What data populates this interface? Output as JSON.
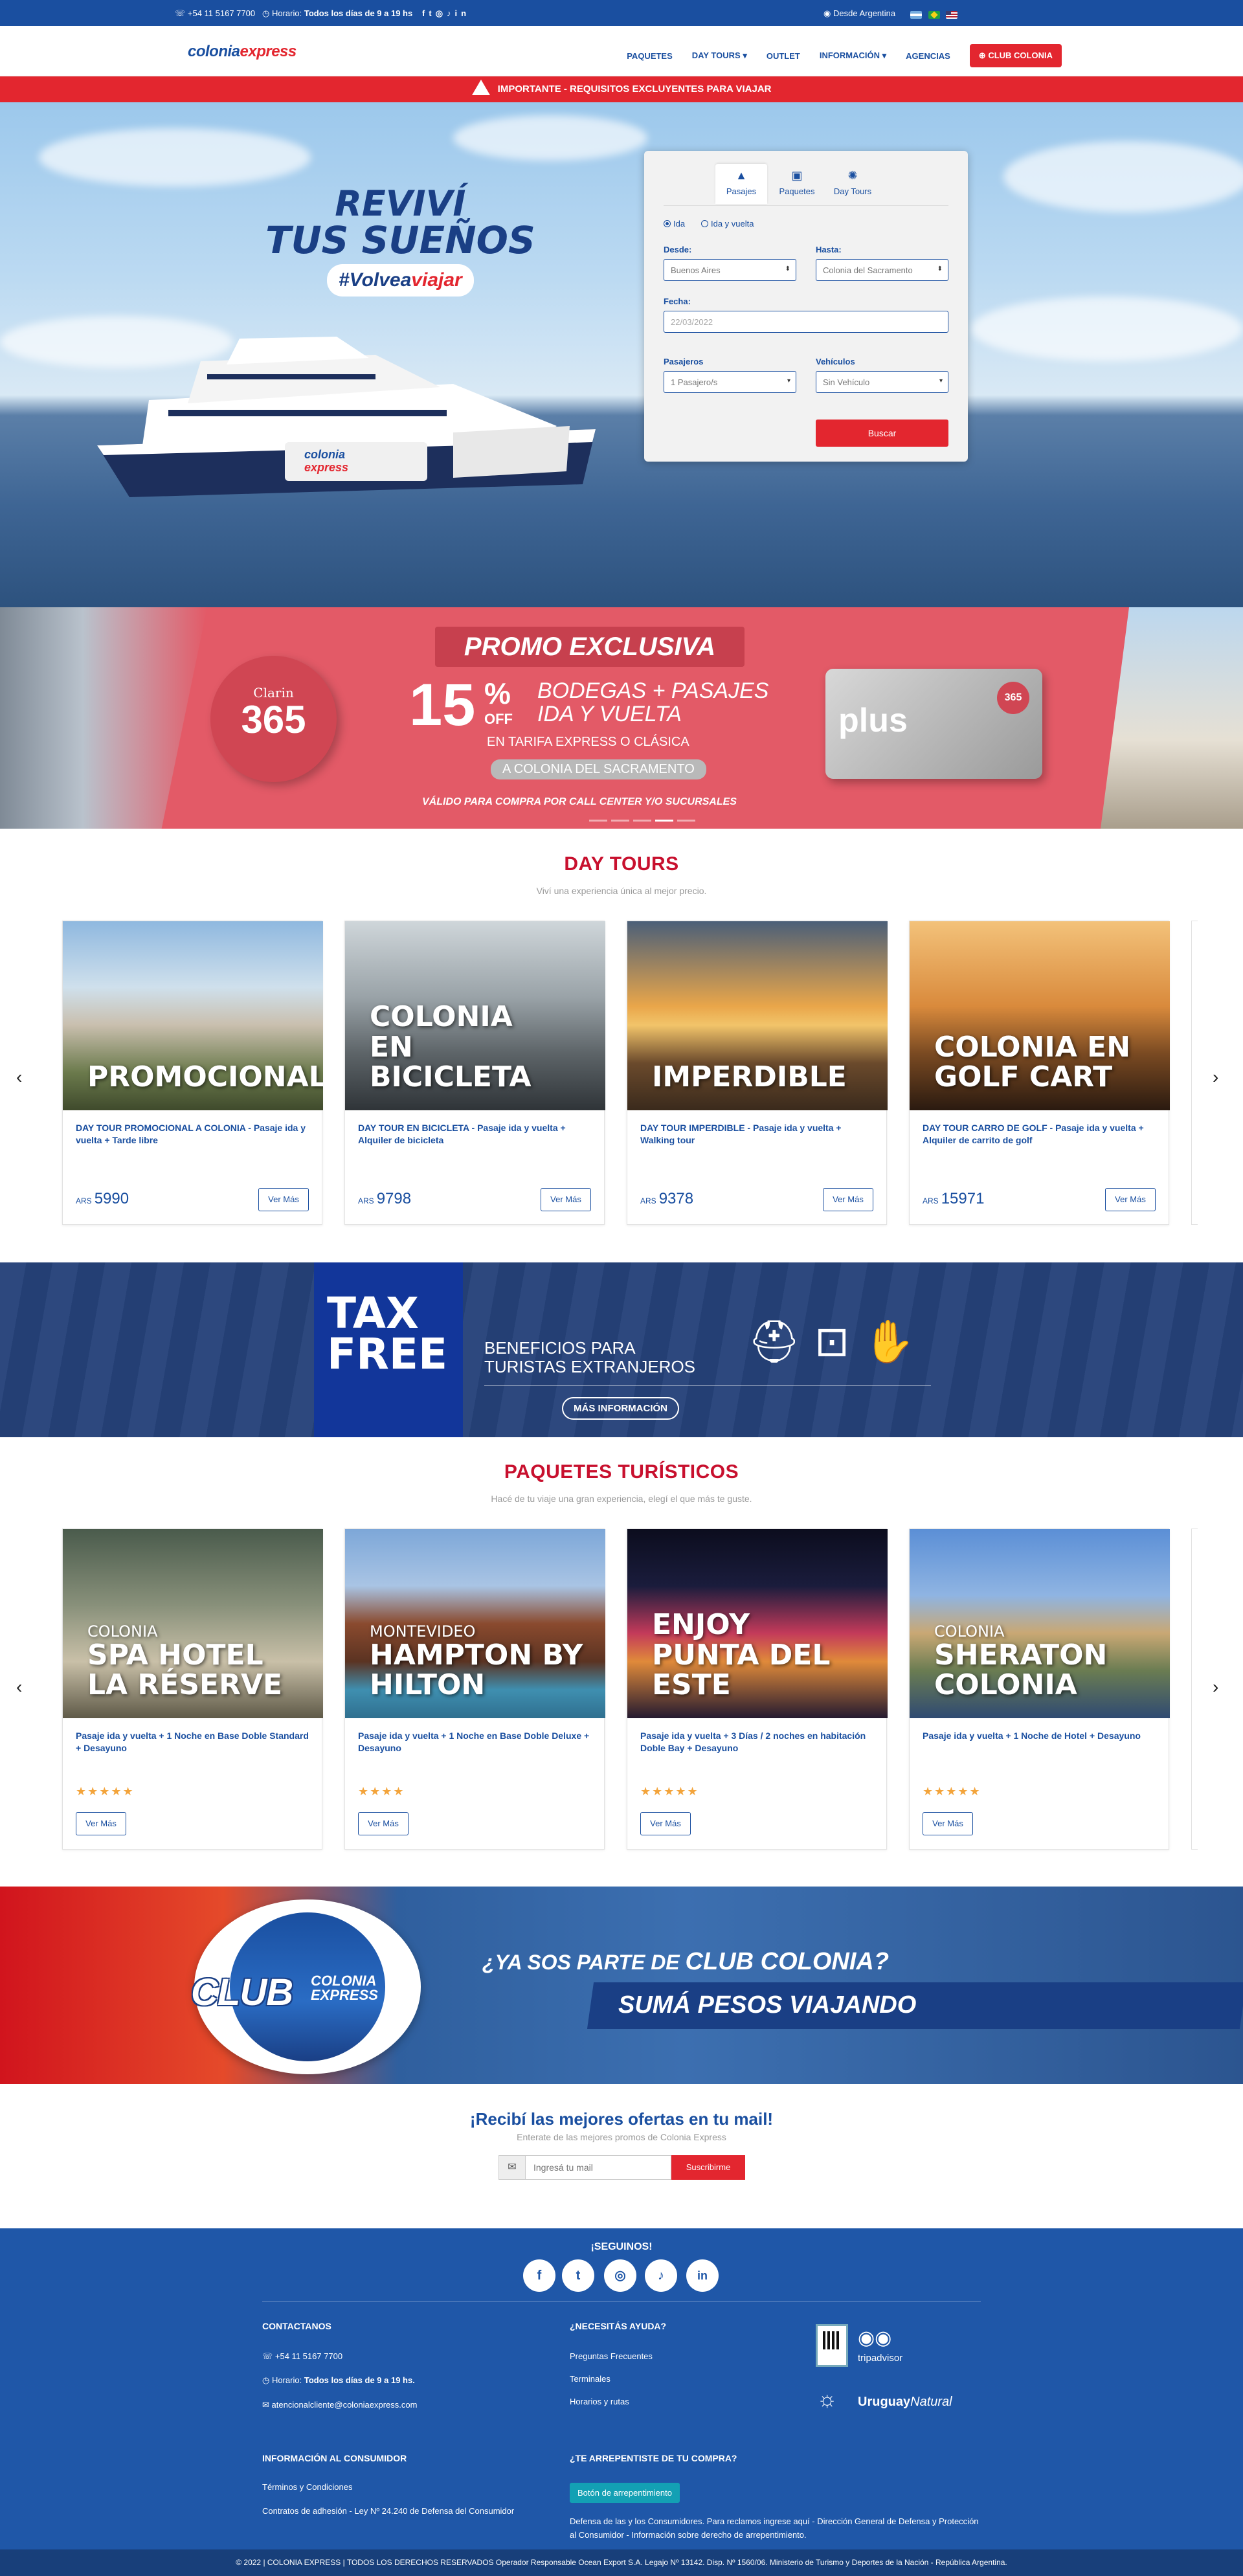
{
  "topbar": {
    "phone": "+54 11 5167 7700",
    "hours_prefix": "Horario:",
    "hours": "Todos los días de 9 a 19 hs",
    "location": "Desde Argentina"
  },
  "nav": {
    "logo_a": "colonia",
    "logo_b": "express",
    "links": [
      "PAQUETES",
      "DAY TOURS",
      "OUTLET",
      "INFORMACIÓN",
      "AGENCIAS"
    ],
    "club": "CLUB COLONIA"
  },
  "alert": "IMPORTANTE - REQUISITOS EXCLUYENTES PARA VIAJAR",
  "hero": {
    "line1": "REVIVÍ",
    "line2": "TUS SUEÑOS",
    "tag_a": "#Volvea",
    "tag_b": "viajar",
    "ship_label_a": "colonia",
    "ship_label_b": "express"
  },
  "search": {
    "tabs": [
      "Pasajes",
      "Paquetes",
      "Day Tours"
    ],
    "trip_types": [
      "Ida",
      "Ida y vuelta"
    ],
    "from_label": "Desde:",
    "from_value": "Buenos Aires",
    "to_label": "Hasta:",
    "to_value": "Colonia del Sacramento",
    "date_label": "Fecha:",
    "date_placeholder": "22/03/2022",
    "pax_label": "Pasajeros",
    "pax_value": "1 Pasajero/s",
    "veh_label": "Vehículos",
    "veh_value": "Sin Vehículo",
    "button": "Buscar"
  },
  "promo": {
    "title": "PROMO EXCLUSIVA",
    "brand": "Clarin",
    "brand_num": "365",
    "percent": "15",
    "off": "OFF",
    "headline_1": "BODEGAS + PASAJES",
    "headline_2": "IDA Y VUELTA",
    "tarifa": "EN TARIFA EXPRESS O CLÁSICA",
    "dest": "A COLONIA DEL SACRAMENTO",
    "valid": "VÁLIDO PARA COMPRA POR CALL CENTER Y/O SUCURSALES",
    "card_text": "plus"
  },
  "daytours": {
    "title": "DAY TOURS",
    "subtitle": "Viví una experiencia única al mejor precio.",
    "cards": [
      {
        "caption": "PROMOCIONAL",
        "caption_sub": "",
        "desc": "DAY TOUR PROMOCIONAL A COLONIA - Pasaje ida y vuelta + Tarde libre",
        "currency": "ARS",
        "price": "5990",
        "more": "Ver Más"
      },
      {
        "caption": "COLONIA EN BICICLETA",
        "caption_sub": "",
        "desc": "DAY TOUR EN BICICLETA - Pasaje ida y vuelta + Alquiler de bicicleta",
        "currency": "ARS",
        "price": "9798",
        "more": "Ver Más"
      },
      {
        "caption": "IMPERDIBLE",
        "caption_sub": "",
        "desc": "DAY TOUR IMPERDIBLE - Pasaje ida y vuelta + Walking tour",
        "currency": "ARS",
        "price": "9378",
        "more": "Ver Más"
      },
      {
        "caption": "COLONIA EN GOLF CART",
        "caption_sub": "",
        "desc": "DAY TOUR CARRO DE GOLF - Pasaje ida y vuelta + Alquiler de carrito de golf",
        "currency": "ARS",
        "price": "15971",
        "more": "Ver Más"
      }
    ]
  },
  "taxfree": {
    "l1": "TAX",
    "l2": "FREE",
    "text1": "BENEFICIOS PARA",
    "text2": "TURISTAS EXTRANJEROS",
    "button": "MÁS INFORMACIÓN"
  },
  "packages": {
    "title": "PAQUETES TURÍSTICOS",
    "subtitle": "Hacé de tu viaje una gran experiencia, elegí el que más te guste.",
    "cards": [
      {
        "caption_sub": "COLONIA",
        "caption": "SPA HOTEL LA RÉSERVE",
        "desc": "Pasaje ida y vuelta + 1 Noche en Base Doble Standard + Desayuno",
        "stars": "★★★★★",
        "more": "Ver Más"
      },
      {
        "caption_sub": "MONTEVIDEO",
        "caption": "HAMPTON BY HILTON",
        "desc": "Pasaje ida y vuelta + 1 Noche en Base Doble Deluxe + Desayuno",
        "stars": "★★★★",
        "more": "Ver Más"
      },
      {
        "caption_sub": "",
        "caption": "ENJOY PUNTA DEL ESTE",
        "desc": "Pasaje ida y vuelta + 3 Días / 2 noches en habitación Doble Bay + Desayuno",
        "stars": "★★★★★",
        "more": "Ver Más"
      },
      {
        "caption_sub": "COLONIA",
        "caption": "SHERATON COLONIA",
        "desc": "Pasaje ida y vuelta + 1 Noche de Hotel + Desayuno",
        "stars": "★★★★★",
        "more": "Ver Más"
      }
    ]
  },
  "club": {
    "badge_1": "CLUB",
    "badge_2": "COLONIA",
    "badge_3": "EXPRESS",
    "q_a": "¿YA SOS PARTE DE",
    "q_b": "CLUB COLONIA?",
    "cta": "SUMÁ PESOS VIAJANDO"
  },
  "newsletter": {
    "title": "¡Recibí las mejores ofertas en tu mail!",
    "subtitle": "Enterate de las mejores promos de Colonia Express",
    "placeholder": "Ingresá tu mail",
    "button": "Suscribirme"
  },
  "footer": {
    "follow": "¡SEGUINOS!",
    "contact_title": "CONTACTANOS",
    "contact_phone": "+54 11 5167 7700",
    "contact_hours_prefix": "Horario:",
    "contact_hours": "Todos los días de 9 a 19 hs.",
    "contact_email": "atencionalcliente@coloniaexpress.com",
    "help_title": "¿NECESITÁS AYUDA?",
    "help_links": [
      "Preguntas Frecuentes",
      "Terminales",
      "Horarios y rutas"
    ],
    "tripadvisor": "tripadvisor",
    "uruguay_a": "Uruguay",
    "uruguay_b": "Natural",
    "consumer_title": "INFORMACIÓN AL CONSUMIDOR",
    "consumer_links": [
      "Términos y Condiciones",
      "Contratos de adhesión - Ley Nº 24.240 de Defensa del Consumidor"
    ],
    "regret_title": "¿TE ARREPENTISTE DE TU COMPRA?",
    "regret_button": "Botón de arrepentimiento",
    "regret_text": "Defensa de las y los Consumidores. Para reclamos ingrese aquí - Dirección General de Defensa y Protección al Consumidor - Información sobre derecho de arrepentimiento.",
    "legal": "© 2022 | COLONIA EXPRESS | TODOS LOS DERECHOS RESERVADOS Operador Responsable Ocean Export S.A. Legajo Nº 13142. Disp. Nº 1560/06. Ministerio de Turismo y Deportes de la Nación - República Argentina."
  }
}
